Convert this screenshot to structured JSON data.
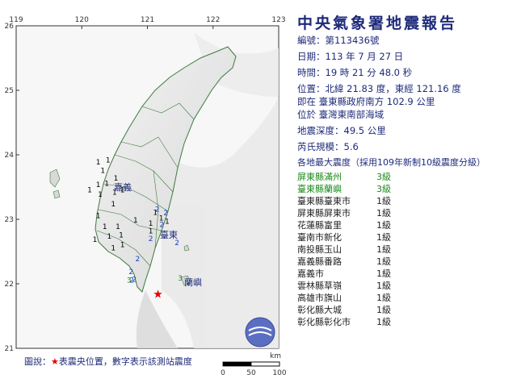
{
  "report": {
    "title": "中央氣象署地震報告",
    "number_label": "編號：",
    "number": "第113436號",
    "date_label": "日期：",
    "date": "113 年 7 月 27 日",
    "time_label": "時間：",
    "time": "19 時 21 分 48.0 秒",
    "position_label": "位置：",
    "position": "北緯 21.83 度，東經 121.16 度",
    "located_line": "即在 臺東縣政府南方 102.9 公里",
    "region_line": "位於 臺灣東南部海域",
    "depth_label": "地震深度：",
    "depth": "49.5 公里",
    "magnitude_label": "芮氏規模：",
    "magnitude": "5.6",
    "intensity_header": "各地最大震度（採用109年新制10級震度分級）"
  },
  "stations": [
    {
      "name": "屏東縣滿州",
      "level": "3級",
      "color": "#1b8a1b"
    },
    {
      "name": "臺東縣蘭嶼",
      "level": "3級",
      "color": "#1b8a1b"
    },
    {
      "name": "臺東縣臺東市",
      "level": "1級",
      "color": "#222222"
    },
    {
      "name": "屏東縣屏東市",
      "level": "1級",
      "color": "#222222"
    },
    {
      "name": "花蓮縣富里",
      "level": "1級",
      "color": "#222222"
    },
    {
      "name": "臺南市新化",
      "level": "1級",
      "color": "#222222"
    },
    {
      "name": "南投縣玉山",
      "level": "1級",
      "color": "#222222"
    },
    {
      "name": "嘉義縣番路",
      "level": "1級",
      "color": "#222222"
    },
    {
      "name": "嘉義市",
      "level": "1級",
      "color": "#222222"
    },
    {
      "name": "雲林縣草嶺",
      "level": "1級",
      "color": "#222222"
    },
    {
      "name": "高雄市旗山",
      "level": "1級",
      "color": "#222222"
    },
    {
      "name": "彰化縣大城",
      "level": "1級",
      "color": "#222222"
    },
    {
      "name": "彰化縣彰化市",
      "level": "1級",
      "color": "#222222"
    }
  ],
  "map": {
    "lon_ticks": [
      "119",
      "120",
      "121",
      "122",
      "123"
    ],
    "lat_ticks": [
      "26",
      "25",
      "24",
      "23",
      "22",
      "21"
    ],
    "epicenter": {
      "lon": 121.16,
      "lat": 21.83,
      "color": "#e60000"
    },
    "place_labels": [
      "嘉義",
      "臺東",
      "蘭嶼"
    ],
    "intensity_marks": [
      {
        "lon": 120.25,
        "lat": 23.85,
        "v": "1",
        "c": "k"
      },
      {
        "lon": 120.4,
        "lat": 23.88,
        "v": "1",
        "c": "k"
      },
      {
        "lon": 120.32,
        "lat": 23.72,
        "v": "1",
        "c": "k"
      },
      {
        "lon": 120.52,
        "lat": 23.6,
        "v": "1",
        "c": "k"
      },
      {
        "lon": 120.25,
        "lat": 23.5,
        "v": "1",
        "c": "k"
      },
      {
        "lon": 120.38,
        "lat": 23.52,
        "v": "1",
        "c": "k"
      },
      {
        "lon": 120.12,
        "lat": 23.42,
        "v": "1",
        "c": "k"
      },
      {
        "lon": 120.28,
        "lat": 23.35,
        "v": "1",
        "c": "k"
      },
      {
        "lon": 120.5,
        "lat": 23.38,
        "v": "1",
        "c": "k"
      },
      {
        "lon": 120.62,
        "lat": 23.42,
        "v": "1",
        "c": "k"
      },
      {
        "lon": 120.48,
        "lat": 23.2,
        "v": "1",
        "c": "k"
      },
      {
        "lon": 120.25,
        "lat": 23.02,
        "v": "1",
        "c": "k"
      },
      {
        "lon": 120.35,
        "lat": 22.85,
        "v": "1",
        "c": "k"
      },
      {
        "lon": 120.2,
        "lat": 22.65,
        "v": "1",
        "c": "k"
      },
      {
        "lon": 120.42,
        "lat": 22.7,
        "v": "1",
        "c": "k"
      },
      {
        "lon": 120.48,
        "lat": 22.52,
        "v": "1",
        "c": "k"
      },
      {
        "lon": 120.6,
        "lat": 22.72,
        "v": "1",
        "c": "k"
      },
      {
        "lon": 120.62,
        "lat": 22.57,
        "v": "1",
        "c": "k"
      },
      {
        "lon": 120.55,
        "lat": 22.85,
        "v": "1",
        "c": "k"
      },
      {
        "lon": 120.82,
        "lat": 22.95,
        "v": "1",
        "c": "k"
      },
      {
        "lon": 121.05,
        "lat": 22.9,
        "v": "1",
        "c": "k"
      },
      {
        "lon": 121.12,
        "lat": 23.07,
        "v": "1",
        "c": "k"
      },
      {
        "lon": 121.05,
        "lat": 22.78,
        "v": "1",
        "c": "k"
      },
      {
        "lon": 121.21,
        "lat": 22.98,
        "v": "1",
        "c": "k"
      },
      {
        "lon": 121.28,
        "lat": 23.06,
        "v": "2",
        "c": "b"
      },
      {
        "lon": 121.3,
        "lat": 22.93,
        "v": "1",
        "c": "k"
      },
      {
        "lon": 121.15,
        "lat": 23.12,
        "v": "2",
        "c": "b"
      },
      {
        "lon": 121.22,
        "lat": 22.88,
        "v": "2",
        "c": "b"
      },
      {
        "lon": 121.05,
        "lat": 22.66,
        "v": "2",
        "c": "b"
      },
      {
        "lon": 121.45,
        "lat": 22.6,
        "v": "2",
        "c": "b"
      },
      {
        "lon": 120.85,
        "lat": 22.35,
        "v": "2",
        "c": "b"
      },
      {
        "lon": 120.8,
        "lat": 22.03,
        "v": "2",
        "c": "b"
      },
      {
        "lon": 120.75,
        "lat": 22.15,
        "v": "2",
        "c": "b"
      },
      {
        "lon": 120.72,
        "lat": 22.02,
        "v": "3",
        "c": "g"
      },
      {
        "lon": 120.76,
        "lat": 22.02,
        "v": "2",
        "c": "b"
      },
      {
        "lon": 121.5,
        "lat": 22.05,
        "v": "3",
        "c": "g"
      }
    ]
  },
  "legend": {
    "prefix": "圖說：",
    "star": "★",
    "text": "表震央位置，數字表示該測站震度"
  },
  "scale": {
    "unit": "km",
    "labels": [
      "0",
      "50",
      "100"
    ]
  }
}
